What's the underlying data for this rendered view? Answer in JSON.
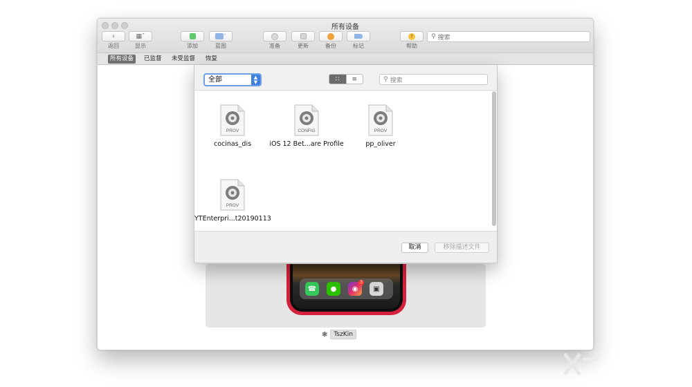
{
  "window": {
    "title": "所有设备"
  },
  "toolbar": {
    "back": "返回",
    "display": "显示",
    "add": "添加",
    "blueprint": "蓝图",
    "prepare": "准备",
    "update": "更新",
    "backup": "备份",
    "tag": "标记",
    "help": "帮助",
    "search_placeholder": "搜索"
  },
  "segments": [
    {
      "label": "所有设备",
      "active": true
    },
    {
      "label": "已监督",
      "active": false
    },
    {
      "label": "未受监督",
      "active": false
    },
    {
      "label": "恢复",
      "active": false
    }
  ],
  "device": {
    "name": "TszKin",
    "instagram_badge": "3"
  },
  "sheet": {
    "filter_selected": "全部",
    "search_placeholder": "搜索",
    "files": [
      {
        "name": "cocinas_dis",
        "type": "PROV"
      },
      {
        "name": "iOS 12 Bet...are Profile",
        "type": "CONFIG"
      },
      {
        "name": "pp_oliver",
        "type": "PROV"
      },
      {
        "name": "YTEnterpri...t20190113",
        "type": "PROV"
      }
    ],
    "cancel_label": "取消",
    "remove_label": "移除描述文件"
  },
  "colors": {
    "accent_blue": "#3f7fe0",
    "phone_red": "#d4213b",
    "add_green": "#5fc86b",
    "backup_orange": "#f0a23a",
    "help_yellow": "#f5c542"
  }
}
